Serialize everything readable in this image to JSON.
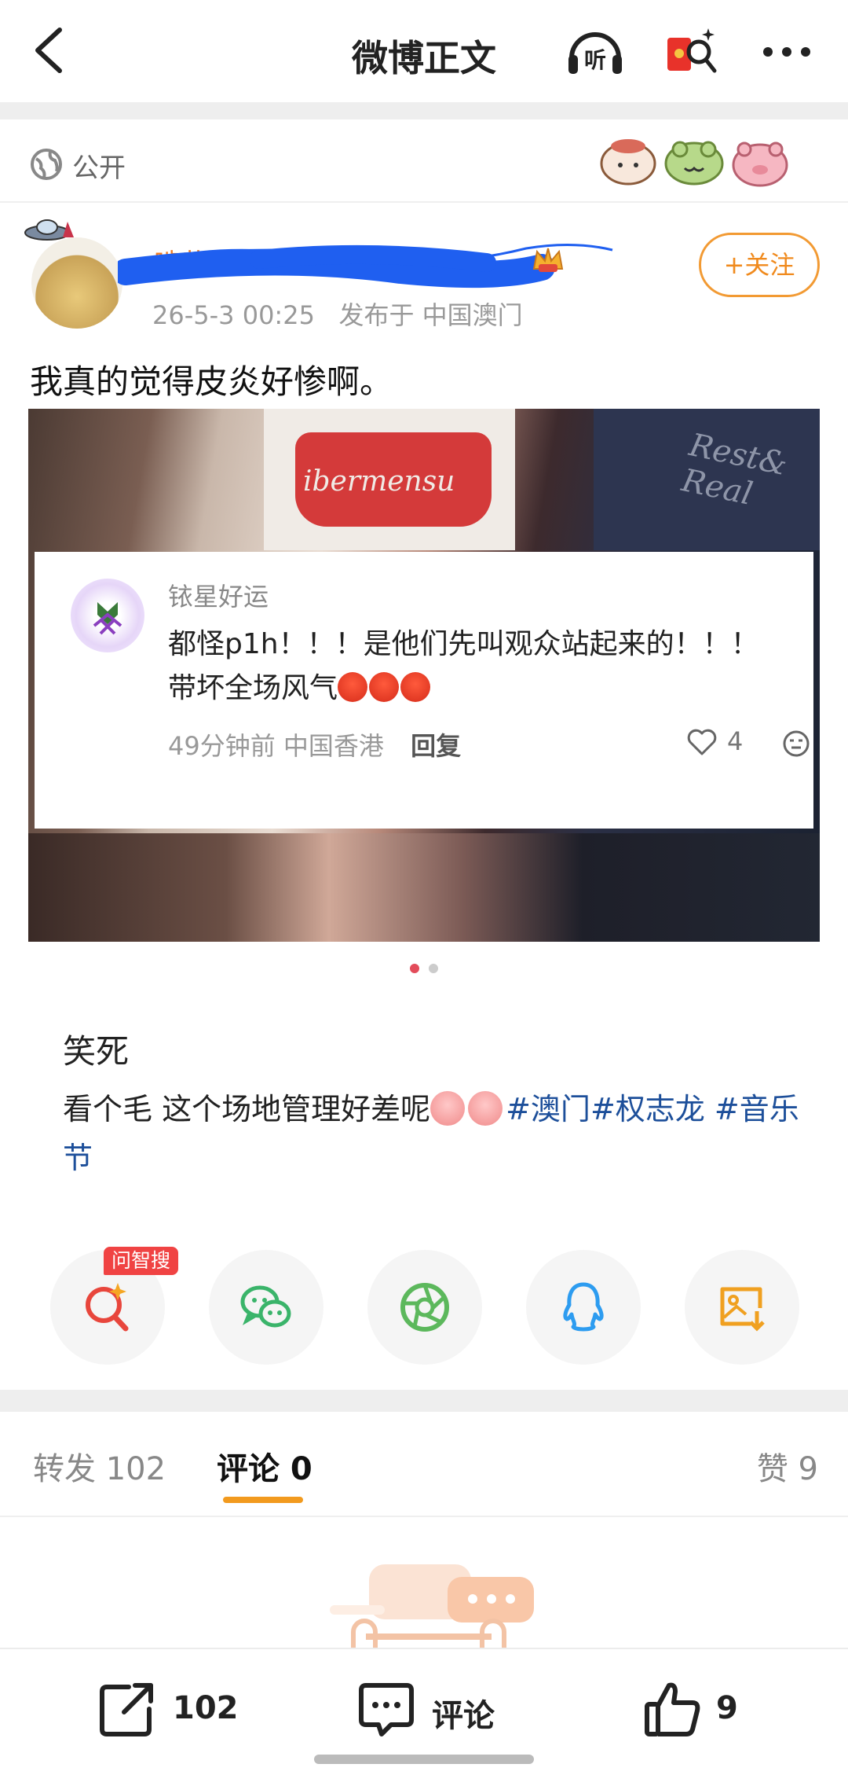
{
  "header": {
    "title": "微博正文",
    "listen_icon": "headphones-listen-icon",
    "listen_label": "听",
    "redpacket_icon": "red-packet-icon",
    "more_icon": "more-dots-icon"
  },
  "visibility": {
    "icon": "globe-icon",
    "label": "公开"
  },
  "post": {
    "username": "啃黄米…",
    "timestamp": "26-5-3 00:25",
    "location": "发布于 中国澳门",
    "follow_label": "+关注",
    "text": "我真的觉得皮炎好惨啊。",
    "image": {
      "shirt_text": "ibermensu",
      "jeans_text": "Rest& Real",
      "page_count": 2,
      "active_page": 1
    },
    "quoted_comment": {
      "name": "铱星好运",
      "text": "都怪p1h！！！是他们先叫观众站起来的！！！带坏全场风气",
      "time": "49分钟前",
      "location": "中国香港",
      "reply_label": "回复",
      "likes": "4"
    },
    "caption_title": "笑死",
    "caption_text": "看个毛 这个场地管理好差呢",
    "hashtags": [
      "#澳门",
      "#权志龙",
      "#音乐节"
    ]
  },
  "share": {
    "badge": "问智搜",
    "items": [
      "search-ai",
      "wechat",
      "moments",
      "qq",
      "save-image"
    ]
  },
  "tabs": {
    "repost": "转发 102",
    "comment": "评论 0",
    "like": "赞 9"
  },
  "bottom_bar": {
    "repost_count": "102",
    "comment_label": "评论",
    "like_count": "9"
  },
  "colors": {
    "accent_orange": "#f29a1e",
    "hashtag_blue": "#1d4f9a",
    "badge_red": "#f04343"
  }
}
